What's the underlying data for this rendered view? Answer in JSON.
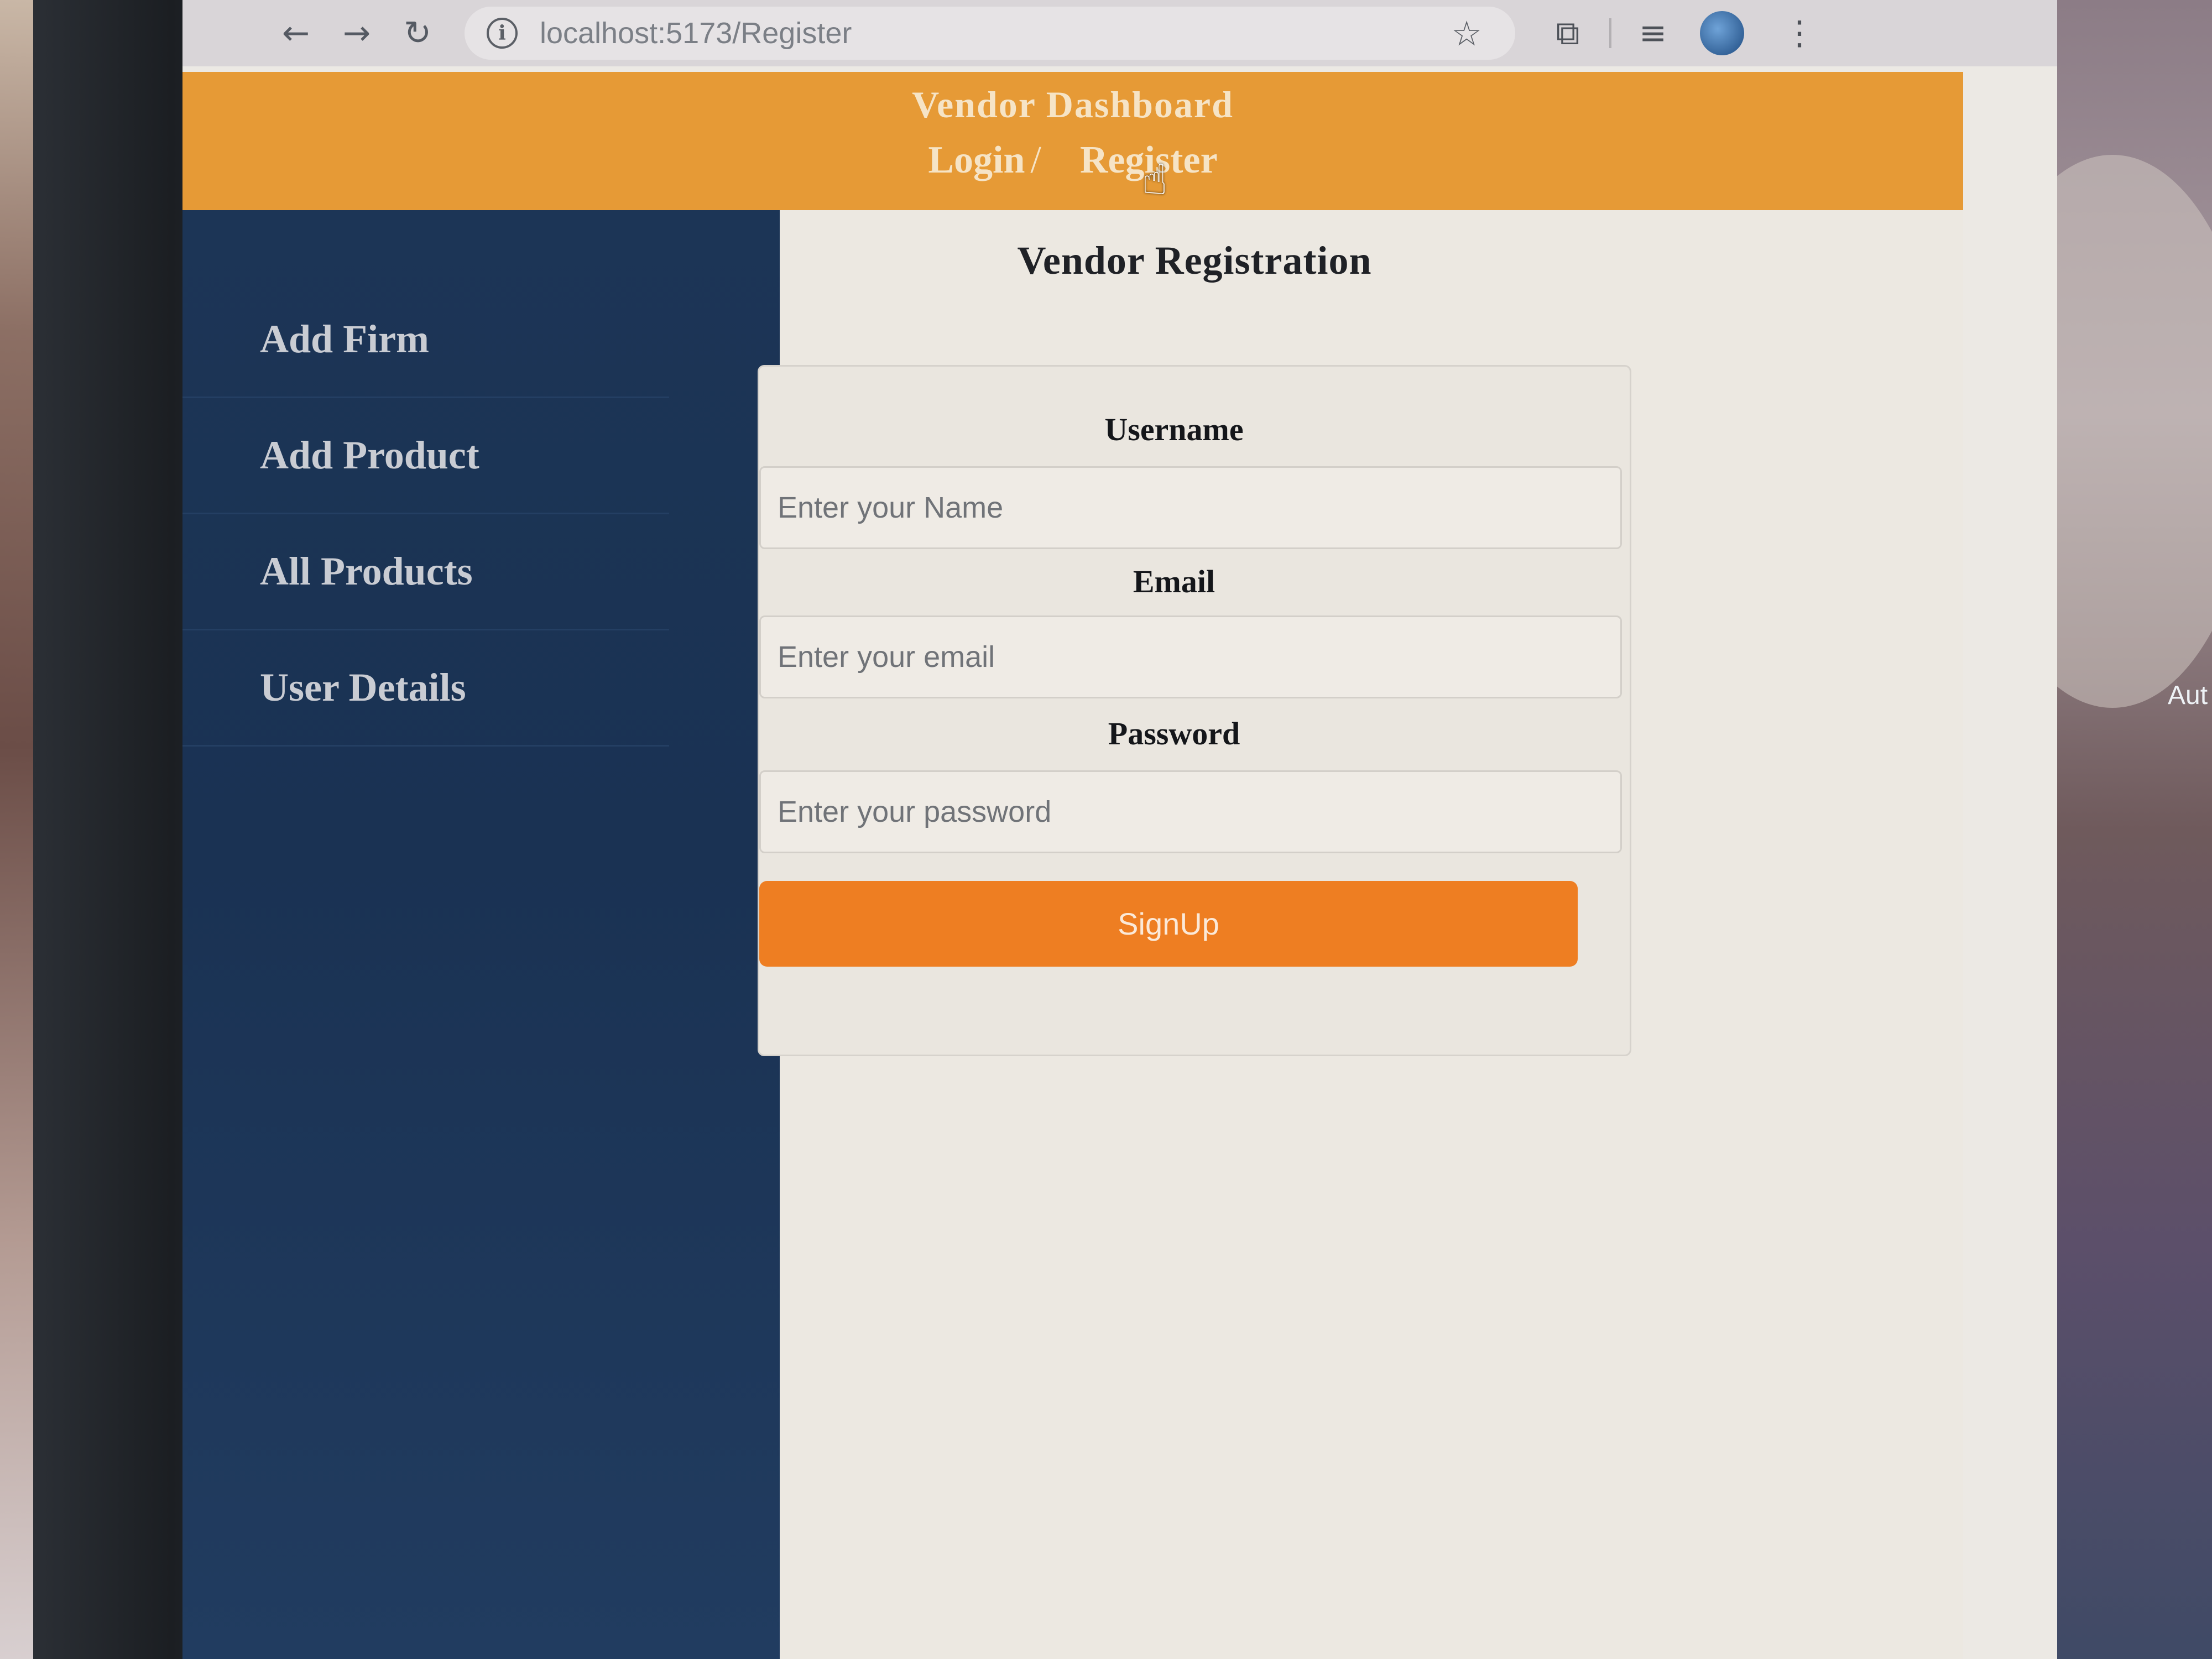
{
  "browser": {
    "url": "localhost:5173/Register",
    "icons": {
      "back": "arrow-left-icon",
      "forward": "arrow-right-icon",
      "reload": "reload-icon",
      "info": "info-icon",
      "bookmark": "star-icon",
      "extensions": "puzzle-icon",
      "media": "playlist-icon",
      "profile": "avatar-icon",
      "menu": "vertical-dots-icon"
    }
  },
  "header": {
    "title": "Vendor Dashboard",
    "login_label": "Login",
    "separator": "/",
    "register_label": "Register",
    "background_color": "#e69a36"
  },
  "sidebar": {
    "background_color": "#1c3556",
    "items": [
      {
        "label": "Add Firm"
      },
      {
        "label": "Add Product"
      },
      {
        "label": "All Products"
      },
      {
        "label": "User Details"
      }
    ]
  },
  "form": {
    "title": "Vendor Registration",
    "username": {
      "label": "Username",
      "placeholder": "Enter your Name"
    },
    "email": {
      "label": "Email",
      "placeholder": "Enter your email"
    },
    "password": {
      "label": "Password",
      "placeholder": "Enter your password"
    },
    "submit_label": "SignUp",
    "submit_color": "#ee7e22"
  },
  "background_text": "Aut"
}
